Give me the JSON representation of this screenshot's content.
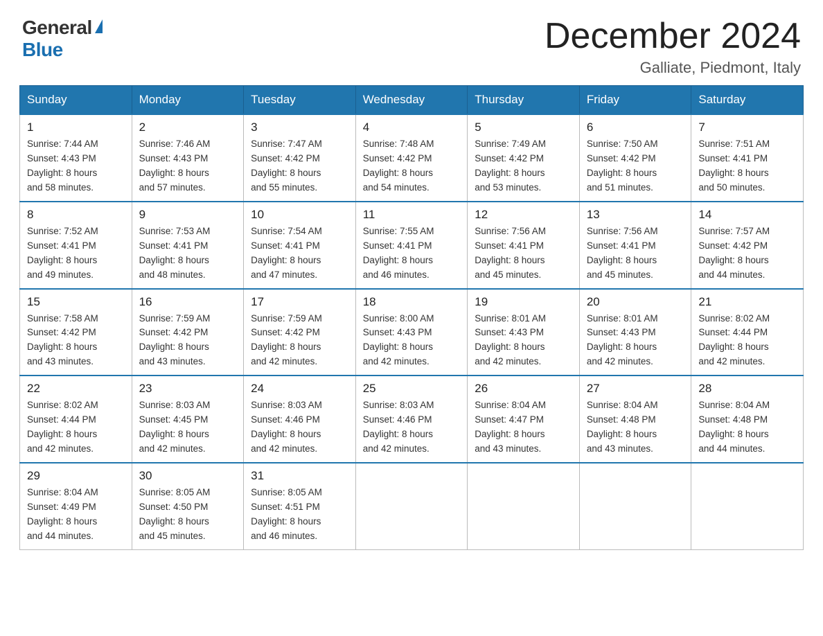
{
  "header": {
    "logo_general": "General",
    "logo_blue": "Blue",
    "month_title": "December 2024",
    "location": "Galliate, Piedmont, Italy"
  },
  "days_of_week": [
    "Sunday",
    "Monday",
    "Tuesday",
    "Wednesday",
    "Thursday",
    "Friday",
    "Saturday"
  ],
  "weeks": [
    [
      {
        "day": "1",
        "sunrise": "7:44 AM",
        "sunset": "4:43 PM",
        "daylight": "8 hours and 58 minutes."
      },
      {
        "day": "2",
        "sunrise": "7:46 AM",
        "sunset": "4:43 PM",
        "daylight": "8 hours and 57 minutes."
      },
      {
        "day": "3",
        "sunrise": "7:47 AM",
        "sunset": "4:42 PM",
        "daylight": "8 hours and 55 minutes."
      },
      {
        "day": "4",
        "sunrise": "7:48 AM",
        "sunset": "4:42 PM",
        "daylight": "8 hours and 54 minutes."
      },
      {
        "day": "5",
        "sunrise": "7:49 AM",
        "sunset": "4:42 PM",
        "daylight": "8 hours and 53 minutes."
      },
      {
        "day": "6",
        "sunrise": "7:50 AM",
        "sunset": "4:42 PM",
        "daylight": "8 hours and 51 minutes."
      },
      {
        "day": "7",
        "sunrise": "7:51 AM",
        "sunset": "4:41 PM",
        "daylight": "8 hours and 50 minutes."
      }
    ],
    [
      {
        "day": "8",
        "sunrise": "7:52 AM",
        "sunset": "4:41 PM",
        "daylight": "8 hours and 49 minutes."
      },
      {
        "day": "9",
        "sunrise": "7:53 AM",
        "sunset": "4:41 PM",
        "daylight": "8 hours and 48 minutes."
      },
      {
        "day": "10",
        "sunrise": "7:54 AM",
        "sunset": "4:41 PM",
        "daylight": "8 hours and 47 minutes."
      },
      {
        "day": "11",
        "sunrise": "7:55 AM",
        "sunset": "4:41 PM",
        "daylight": "8 hours and 46 minutes."
      },
      {
        "day": "12",
        "sunrise": "7:56 AM",
        "sunset": "4:41 PM",
        "daylight": "8 hours and 45 minutes."
      },
      {
        "day": "13",
        "sunrise": "7:56 AM",
        "sunset": "4:41 PM",
        "daylight": "8 hours and 45 minutes."
      },
      {
        "day": "14",
        "sunrise": "7:57 AM",
        "sunset": "4:42 PM",
        "daylight": "8 hours and 44 minutes."
      }
    ],
    [
      {
        "day": "15",
        "sunrise": "7:58 AM",
        "sunset": "4:42 PM",
        "daylight": "8 hours and 43 minutes."
      },
      {
        "day": "16",
        "sunrise": "7:59 AM",
        "sunset": "4:42 PM",
        "daylight": "8 hours and 43 minutes."
      },
      {
        "day": "17",
        "sunrise": "7:59 AM",
        "sunset": "4:42 PM",
        "daylight": "8 hours and 42 minutes."
      },
      {
        "day": "18",
        "sunrise": "8:00 AM",
        "sunset": "4:43 PM",
        "daylight": "8 hours and 42 minutes."
      },
      {
        "day": "19",
        "sunrise": "8:01 AM",
        "sunset": "4:43 PM",
        "daylight": "8 hours and 42 minutes."
      },
      {
        "day": "20",
        "sunrise": "8:01 AM",
        "sunset": "4:43 PM",
        "daylight": "8 hours and 42 minutes."
      },
      {
        "day": "21",
        "sunrise": "8:02 AM",
        "sunset": "4:44 PM",
        "daylight": "8 hours and 42 minutes."
      }
    ],
    [
      {
        "day": "22",
        "sunrise": "8:02 AM",
        "sunset": "4:44 PM",
        "daylight": "8 hours and 42 minutes."
      },
      {
        "day": "23",
        "sunrise": "8:03 AM",
        "sunset": "4:45 PM",
        "daylight": "8 hours and 42 minutes."
      },
      {
        "day": "24",
        "sunrise": "8:03 AM",
        "sunset": "4:46 PM",
        "daylight": "8 hours and 42 minutes."
      },
      {
        "day": "25",
        "sunrise": "8:03 AM",
        "sunset": "4:46 PM",
        "daylight": "8 hours and 42 minutes."
      },
      {
        "day": "26",
        "sunrise": "8:04 AM",
        "sunset": "4:47 PM",
        "daylight": "8 hours and 43 minutes."
      },
      {
        "day": "27",
        "sunrise": "8:04 AM",
        "sunset": "4:48 PM",
        "daylight": "8 hours and 43 minutes."
      },
      {
        "day": "28",
        "sunrise": "8:04 AM",
        "sunset": "4:48 PM",
        "daylight": "8 hours and 44 minutes."
      }
    ],
    [
      {
        "day": "29",
        "sunrise": "8:04 AM",
        "sunset": "4:49 PM",
        "daylight": "8 hours and 44 minutes."
      },
      {
        "day": "30",
        "sunrise": "8:05 AM",
        "sunset": "4:50 PM",
        "daylight": "8 hours and 45 minutes."
      },
      {
        "day": "31",
        "sunrise": "8:05 AM",
        "sunset": "4:51 PM",
        "daylight": "8 hours and 46 minutes."
      },
      null,
      null,
      null,
      null
    ]
  ],
  "labels": {
    "sunrise": "Sunrise:",
    "sunset": "Sunset:",
    "daylight": "Daylight:"
  }
}
